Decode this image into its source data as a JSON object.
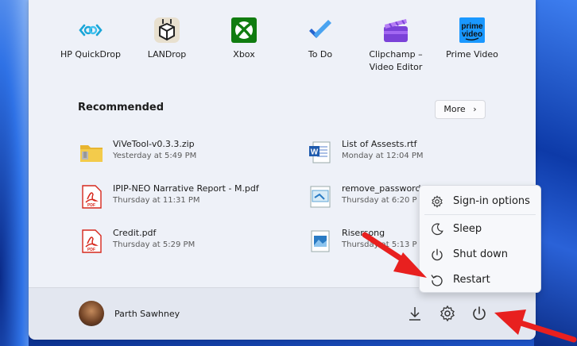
{
  "pinned_apps": [
    {
      "label": "HP QuickDrop",
      "icon": "hp-quickdrop-icon"
    },
    {
      "label": "LANDrop",
      "icon": "landrop-icon"
    },
    {
      "label": "Xbox",
      "icon": "xbox-icon"
    },
    {
      "label": "To Do",
      "icon": "todo-icon"
    },
    {
      "label": "Clipchamp –\nVideo Editor",
      "label_line1": "Clipchamp –",
      "label_line2": "Video Editor",
      "icon": "clipchamp-icon"
    },
    {
      "label": "Prime Video",
      "icon": "prime-video-icon",
      "icon_text1": "prime",
      "icon_text2": "video"
    }
  ],
  "recommended": {
    "title": "Recommended",
    "more_label": "More",
    "items": [
      {
        "name": "ViVeTool-v0.3.3.zip",
        "time": "Yesterday at 5:49 PM",
        "icon": "zip-folder-icon"
      },
      {
        "name": "List of Assests.rtf",
        "time": "Monday at 12:04 PM",
        "icon": "word-doc-icon"
      },
      {
        "name": "IPIP-NEO Narrative Report - M.pdf",
        "time": "Thursday at 11:31 PM",
        "icon": "pdf-icon"
      },
      {
        "name": "remove_password",
        "time": "Thursday at 6:20 P",
        "icon": "script-file-icon"
      },
      {
        "name": "Credit.pdf",
        "time": "Thursday at 5:29 PM",
        "icon": "pdf-icon"
      },
      {
        "name": "Risersong",
        "time": "Thursday at 5:13 P",
        "icon": "image-file-icon"
      }
    ]
  },
  "user": {
    "name": "Parth Sawhney"
  },
  "power_menu": {
    "items": [
      {
        "label": "Sign-in options",
        "icon": "gear-icon"
      },
      {
        "label": "Sleep",
        "icon": "moon-icon"
      },
      {
        "label": "Shut down",
        "icon": "power-icon"
      },
      {
        "label": "Restart",
        "icon": "restart-icon"
      }
    ]
  },
  "colors": {
    "panel_bg": "#eef1f8",
    "footer_bg": "#e3e7f0",
    "arrow_red": "#e8201f",
    "xbox_green": "#107c10",
    "pdf_red": "#d6281c",
    "word_blue": "#1e5aad"
  }
}
